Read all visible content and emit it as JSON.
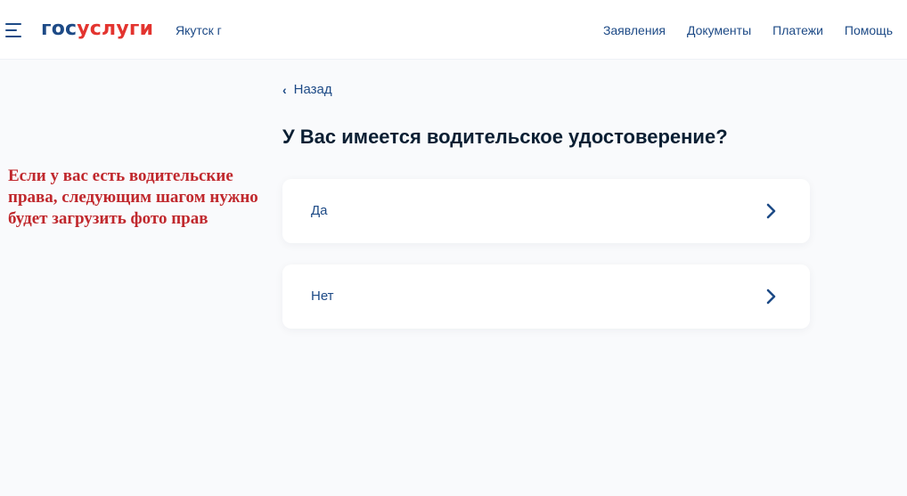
{
  "header": {
    "logo": {
      "part1": "гос",
      "part2": "услуги"
    },
    "city": "Якутск г",
    "nav": [
      "Заявления",
      "Документы",
      "Платежи",
      "Помощь"
    ]
  },
  "back": {
    "icon": "chevron-left-icon",
    "label": "Назад"
  },
  "question": "У Вас имеется водительское удостоверение?",
  "options": [
    {
      "label": "Да",
      "icon": "chevron-right-icon"
    },
    {
      "label": "Нет",
      "icon": "chevron-right-icon"
    }
  ],
  "annotation": "Если у вас есть водительские права, следующим шагом нужно будет загрузить фото прав",
  "colors": {
    "brand_blue": "#1d4a86",
    "brand_red": "#e3342f",
    "annotation_red": "#c0282d",
    "background": "#f9fafc"
  }
}
